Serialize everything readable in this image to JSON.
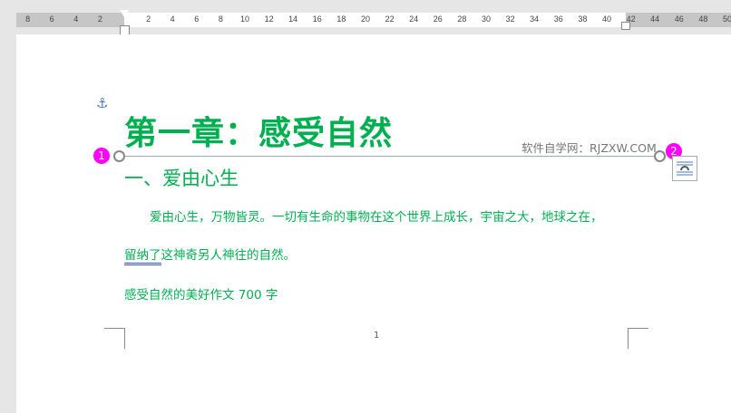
{
  "ruler": {
    "left_ticks": [
      "8",
      "6",
      "4",
      "2"
    ],
    "right_ticks": [
      "2",
      "4",
      "6",
      "8",
      "10",
      "12",
      "14",
      "16",
      "18",
      "20",
      "22",
      "24",
      "26",
      "28",
      "30",
      "32",
      "34",
      "36",
      "38",
      "40"
    ],
    "margin_ticks": [
      "42",
      "44",
      "46",
      "48",
      "50"
    ]
  },
  "document": {
    "title": "第一章：感受自然",
    "watermark": "软件自学网：RJZXW.COM",
    "heading": "一、爱由心生",
    "para1": "爱由心生，万物皆灵。一切有生命的事物在这个世界上成长，宇宙之大，地球之在，",
    "para2_underlined": "留纳了",
    "para2_rest": "这神奇另人神往的自然。",
    "para3": "感受自然的美好作文 700 字",
    "page_number": "1"
  },
  "badges": {
    "one": "1",
    "two": "2"
  },
  "colors": {
    "text_green": "#00b050",
    "badge": "#ff00ff"
  }
}
